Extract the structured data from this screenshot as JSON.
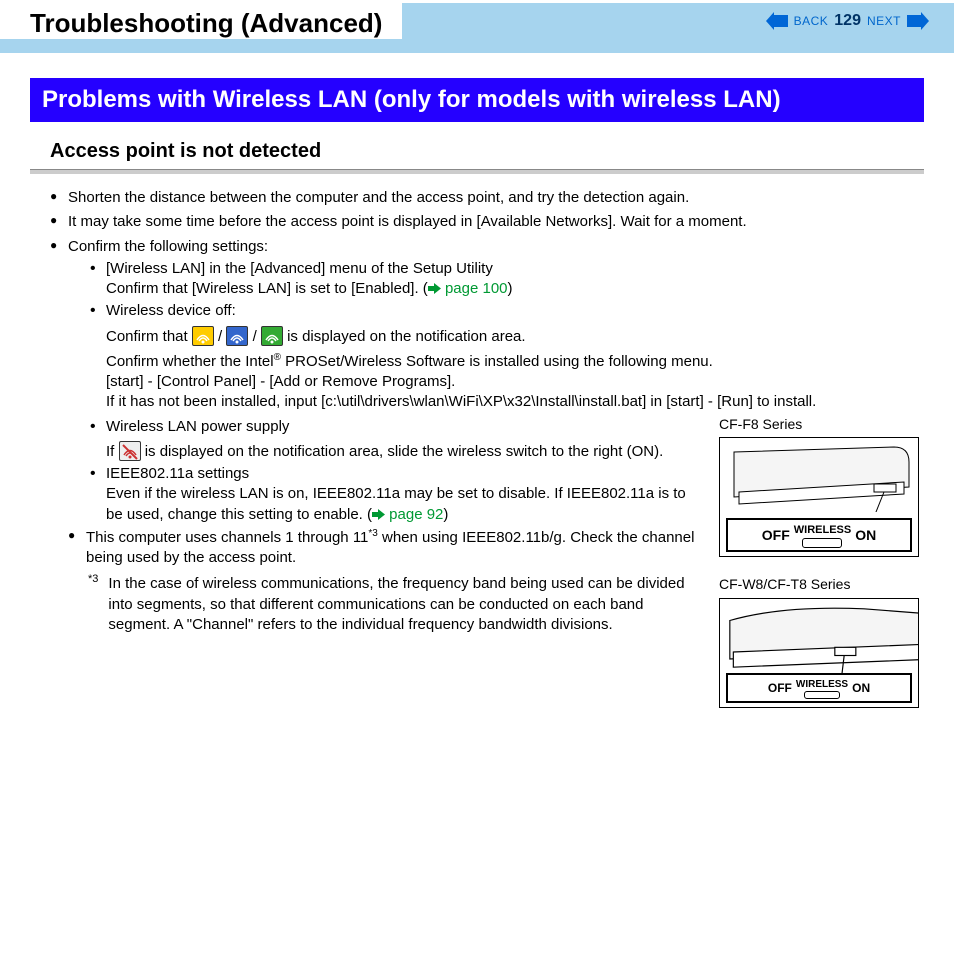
{
  "header": {
    "title": "Troubleshooting (Advanced)",
    "back": "BACK",
    "page": "129",
    "next": "NEXT"
  },
  "blue_heading": "Problems with Wireless LAN (only for models with wireless LAN)",
  "section_heading": "Access point is not detected",
  "bullets": {
    "b1": "Shorten the distance between the computer and the access point, and try the detection again.",
    "b2": "It may take some time before the access point is displayed in [Available Networks]. Wait for a moment.",
    "b3": "Confirm the following settings:",
    "s1": "[Wireless LAN] in the [Advanced] menu of the Setup Utility",
    "s1b_a": "Confirm that [Wireless LAN] is set to [Enabled]. (",
    "s1b_link": " page 100",
    "s1b_c": ")",
    "s2": "Wireless device off:",
    "s2b_a": "Confirm that ",
    "s2b_b": " / ",
    "s2b_c": " / ",
    "s2b_d": " is displayed on the notification area.",
    "s2c_a": "Confirm whether the Intel",
    "s2c_sup": "®",
    "s2c_b": " PROSet/Wireless Software is installed using the following menu.",
    "s2d": "[start] - [Control Panel] - [Add or Remove Programs].",
    "s2e": "If it has not been installed, input [c:\\util\\drivers\\wlan\\WiFi\\XP\\x32\\Install\\install.bat] in [start] - [Run] to install.",
    "s3": "Wireless LAN power supply",
    "s3b_a": "If ",
    "s3b_b": " is displayed on the notification area, slide the wireless switch to the right (ON).",
    "s4": "IEEE802.11a settings",
    "s4b_a": "Even if the wireless LAN is on, IEEE802.11a may be set to disable. If IEEE802.11a is to be used, change this setting to enable. (",
    "s4b_link": " page 92",
    "s4b_c": ")",
    "b4_a": "This computer uses channels 1 through 11",
    "b4_sup": "*3",
    "b4_b": " when using IEEE802.11b/g.  Check the channel being used by the access point."
  },
  "footnote": {
    "mark": "*3",
    "text": "In the case of wireless communications, the frequency band being used can be divided into segments, so that different communications can be conducted on each band segment.  A \"Channel\" refers to the individual frequency bandwidth divisions."
  },
  "figures": {
    "f1_label": "CF-F8 Series",
    "f2_label": "CF-W8/CF-T8 Series",
    "off": "OFF",
    "on": "ON",
    "wireless": "WIRELESS"
  }
}
